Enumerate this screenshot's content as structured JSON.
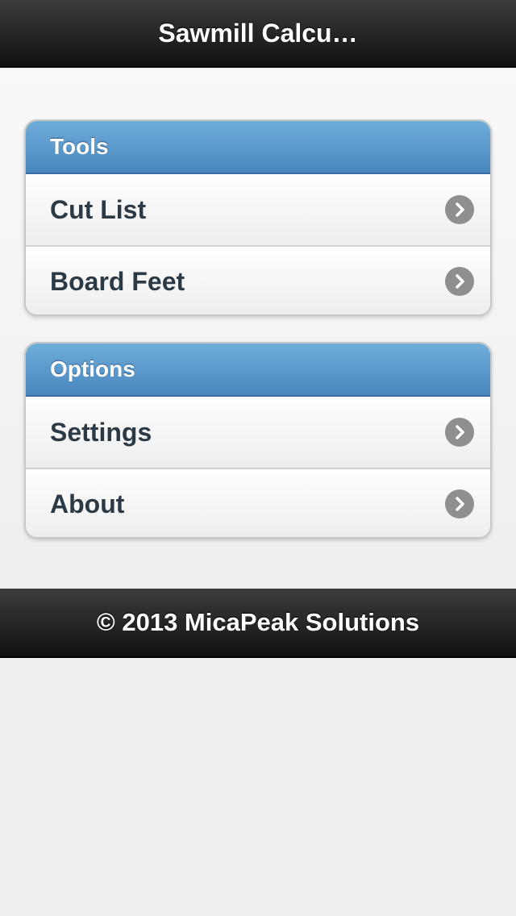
{
  "header": {
    "title": "Sawmill Calcu…"
  },
  "groups": [
    {
      "title": "Tools",
      "items": [
        {
          "label": "Cut List",
          "icon": "chevron-right-icon"
        },
        {
          "label": "Board Feet",
          "icon": "chevron-right-icon"
        }
      ]
    },
    {
      "title": "Options",
      "items": [
        {
          "label": "Settings",
          "icon": "chevron-right-icon"
        },
        {
          "label": "About",
          "icon": "chevron-right-icon"
        }
      ]
    }
  ],
  "footer": {
    "text": "© 2013 MicaPeak Solutions"
  },
  "colors": {
    "bar": "#1a1a1a",
    "group_header": "#5b9bd0",
    "item_text": "#2c3a46",
    "chevron": "#8f8f8f"
  }
}
